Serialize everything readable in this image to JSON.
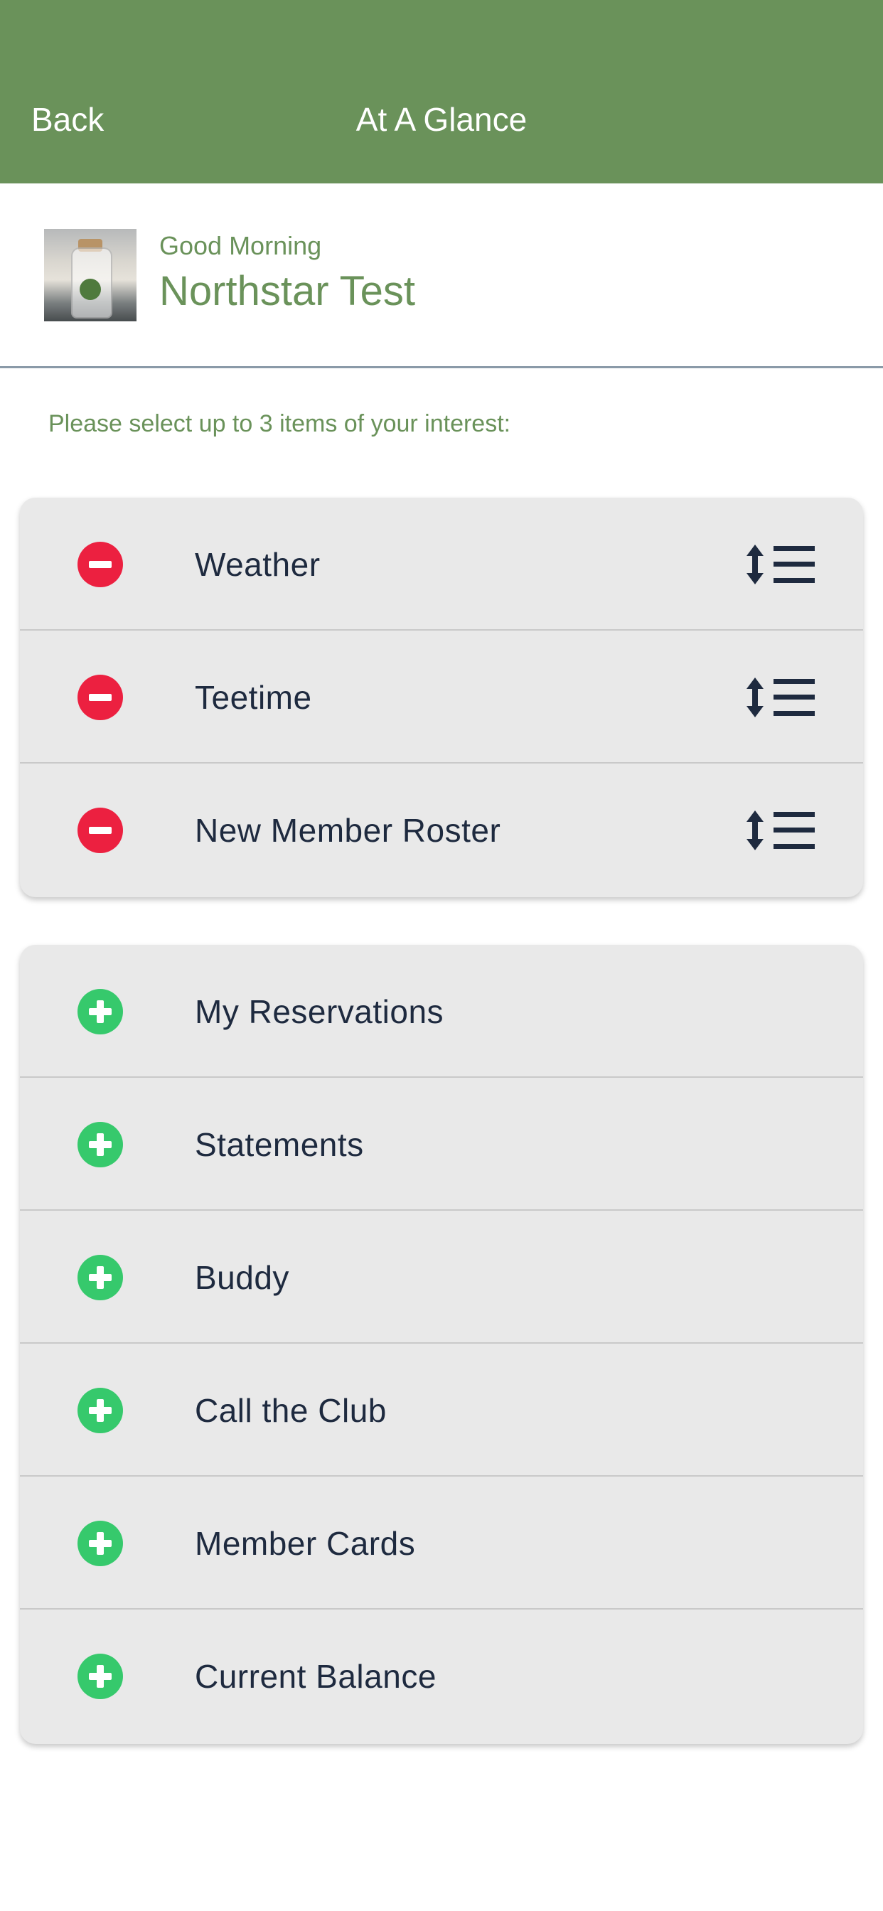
{
  "header": {
    "back_label": "Back",
    "title": "At A Glance",
    "background_color": "#6a925a"
  },
  "greeting": {
    "salutation": "Good Morning",
    "name": "Northstar Test",
    "avatar_icon": "terrarium-jar-photo"
  },
  "instructions": "Please select up to 3 items of your interest:",
  "selected_items": [
    {
      "label": "Weather",
      "action_icon": "minus-circle-icon",
      "handle_icon": "reorder-handle-icon"
    },
    {
      "label": "Teetime",
      "action_icon": "minus-circle-icon",
      "handle_icon": "reorder-handle-icon"
    },
    {
      "label": "New Member Roster",
      "action_icon": "minus-circle-icon",
      "handle_icon": "reorder-handle-icon"
    }
  ],
  "available_items": [
    {
      "label": "My Reservations",
      "action_icon": "plus-circle-icon"
    },
    {
      "label": "Statements",
      "action_icon": "plus-circle-icon"
    },
    {
      "label": "Buddy",
      "action_icon": "plus-circle-icon"
    },
    {
      "label": "Call the Club",
      "action_icon": "plus-circle-icon"
    },
    {
      "label": "Member Cards",
      "action_icon": "plus-circle-icon"
    },
    {
      "label": "Current Balance",
      "action_icon": "plus-circle-icon"
    }
  ],
  "colors": {
    "accent_green": "#6a925a",
    "remove_red": "#ec2040",
    "add_green": "#36c96c",
    "text_dark": "#1e2a3f",
    "card_bg": "#e9e9e9"
  }
}
